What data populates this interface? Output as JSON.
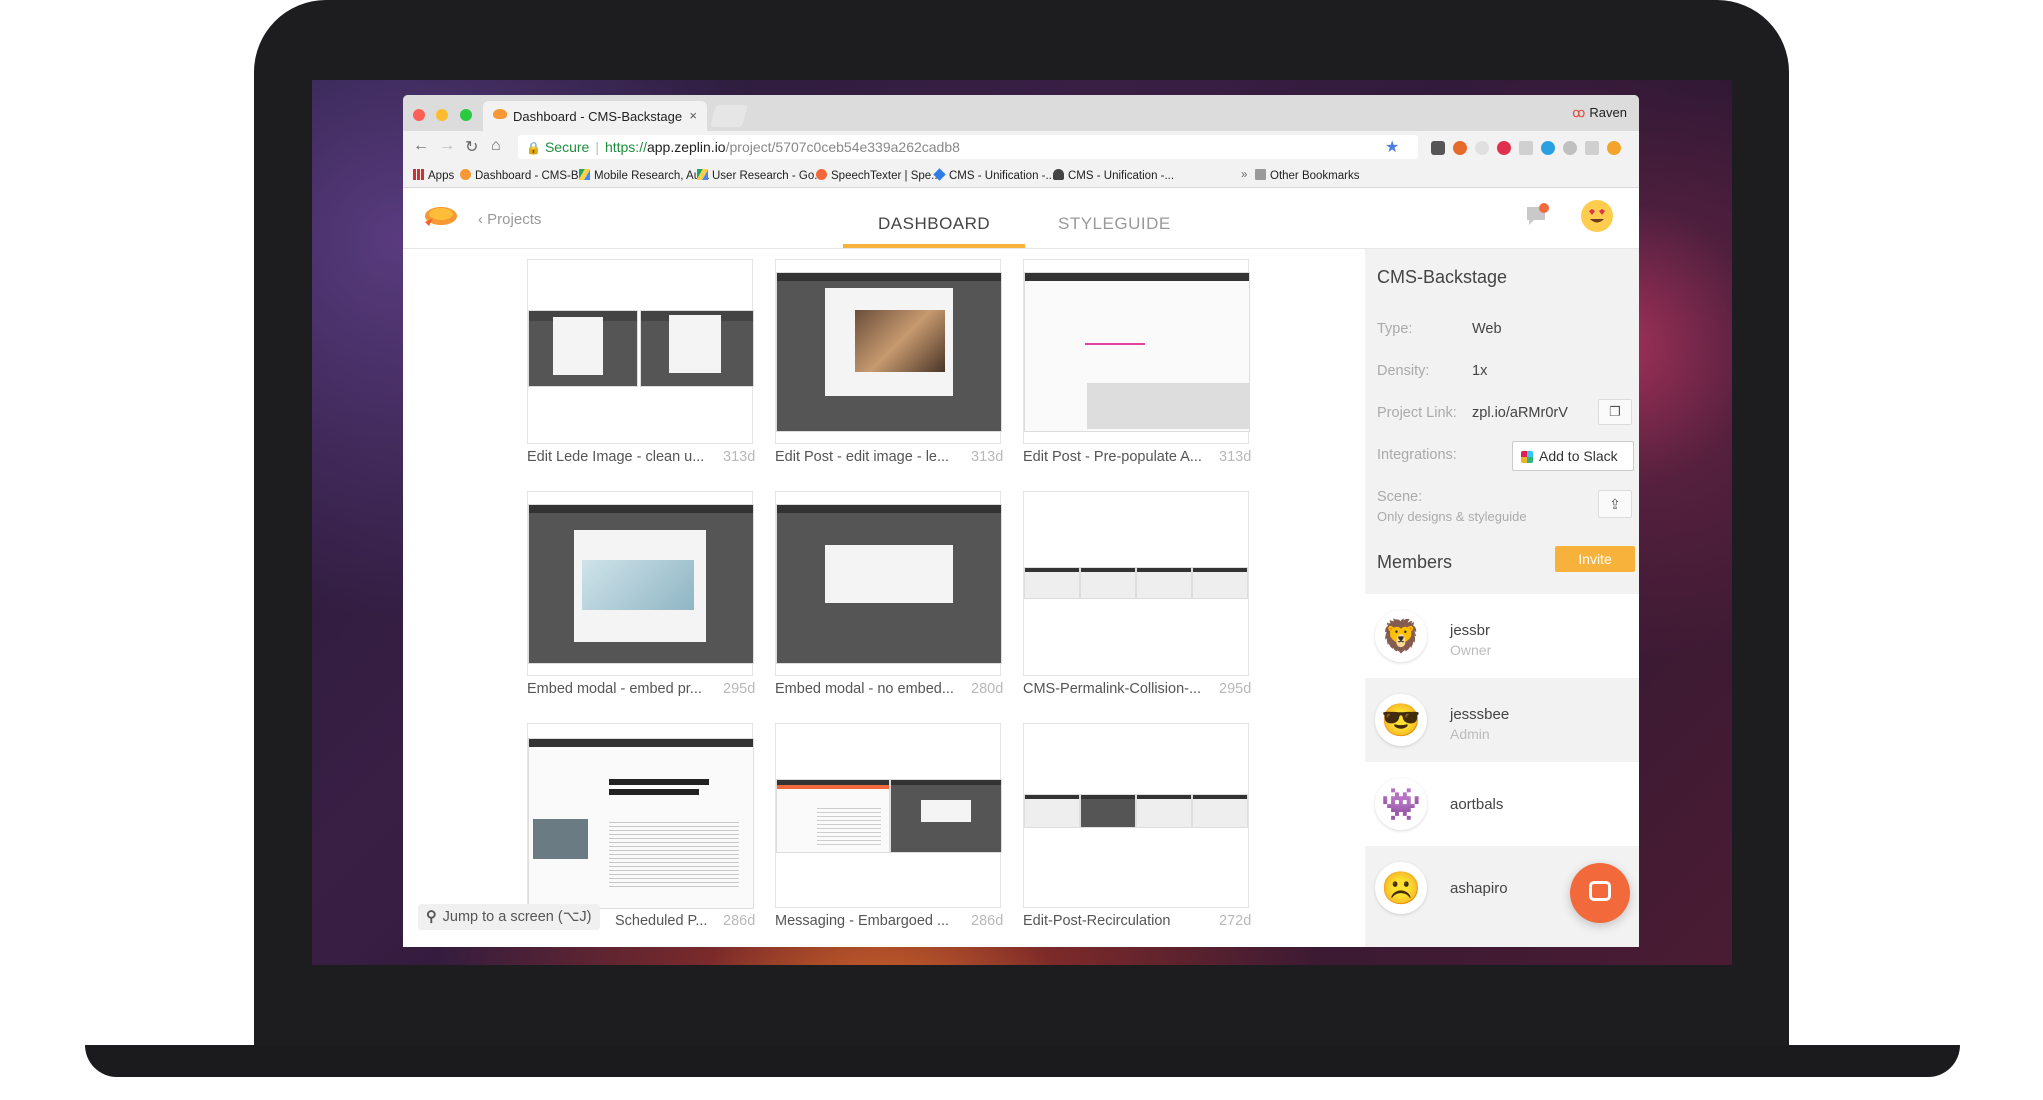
{
  "browser": {
    "tab_title": "Dashboard - CMS-Backstage",
    "profile_name": "Raven",
    "address": {
      "secure_label": "Secure",
      "url_scheme": "https://",
      "url_host": "app.zeplin.io",
      "url_path": "/project/5707c0ceb54e339a262cadb8"
    },
    "bookmarks": [
      {
        "label": "Apps",
        "icon": "apps-grid-icon"
      },
      {
        "label": "Dashboard - CMS-B...",
        "icon": "zeplin-icon"
      },
      {
        "label": "Mobile Research, Au...",
        "icon": "drive-icon"
      },
      {
        "label": "User Research - Go...",
        "icon": "drive-icon"
      },
      {
        "label": "SpeechTexter | Spe...",
        "icon": "speech-icon"
      },
      {
        "label": "CMS - Unification -...",
        "icon": "diamond-icon"
      },
      {
        "label": "CMS - Unification -...",
        "icon": "figure-icon"
      }
    ],
    "other_bookmarks": "Other Bookmarks"
  },
  "app": {
    "back_label": "Projects",
    "tabs": [
      "DASHBOARD",
      "STYLEGUIDE"
    ],
    "active_tab": "DASHBOARD",
    "screens": [
      {
        "name": "Edit Lede Image - clean u...",
        "age": "313d"
      },
      {
        "name": "Edit Post - edit image - le...",
        "age": "313d"
      },
      {
        "name": "Edit Post - Pre-populate A...",
        "age": "313d"
      },
      {
        "name": "Embed modal - embed pr...",
        "age": "295d"
      },
      {
        "name": "Embed modal - no embed...",
        "age": "280d"
      },
      {
        "name": "CMS-Permalink-Collision-...",
        "age": "295d"
      },
      {
        "name": "Scheduled P...",
        "age": "286d"
      },
      {
        "name": "Messaging - Embargoed ...",
        "age": "286d"
      },
      {
        "name": "Edit-Post-Recirculation",
        "age": "272d"
      }
    ],
    "jump_label": "Jump to a screen (⌥J)"
  },
  "sidebar": {
    "project_name": "CMS-Backstage",
    "type_label": "Type:",
    "type_value": "Web",
    "density_label": "Density:",
    "density_value": "1x",
    "link_label": "Project Link:",
    "link_value": "zpl.io/aRMr0rV",
    "integrations_label": "Integrations:",
    "slack_button": "Add to Slack",
    "scene_label": "Scene:",
    "scene_value": "Only designs & styleguide",
    "members_title": "Members",
    "invite_button": "Invite",
    "members": [
      {
        "name": "jessbr",
        "role": "Owner",
        "emoji": "🦁"
      },
      {
        "name": "jesssbee",
        "role": "Admin",
        "emoji": "😎"
      },
      {
        "name": "aortbals",
        "role": "",
        "emoji": "👾"
      },
      {
        "name": "ashapiro",
        "role": "",
        "emoji": "☹️"
      }
    ]
  },
  "colors": {
    "accent": "#f6b23a",
    "chat": "#f26a3b",
    "secure": "#1e8e3e"
  }
}
